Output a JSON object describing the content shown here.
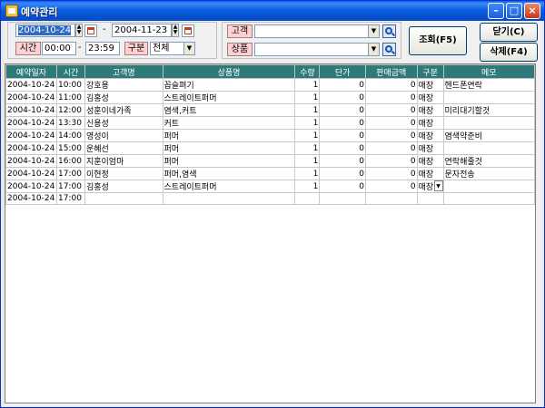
{
  "window": {
    "title": "예약관리"
  },
  "filters": {
    "date_from": "2004-10-24",
    "date_to": "2004-11-23",
    "date_dash": "-",
    "time_label": "시간",
    "time_from": "00:00",
    "time_dash": "-",
    "time_to": "23:59",
    "type_label": "구분",
    "type_value": "전체",
    "customer_label": "고객",
    "customer_value": "",
    "product_label": "상품",
    "product_value": ""
  },
  "buttons": {
    "search": "조회(F5)",
    "close": "닫기(C)",
    "delete": "삭제(F4)"
  },
  "table": {
    "columns": [
      "예약일자",
      "시간",
      "고객명",
      "상품명",
      "수량",
      "단가",
      "판매금액",
      "구분",
      "메모"
    ],
    "rows": [
      [
        "2004-10-24",
        "10:00",
        "강호용",
        "꼽슬펴기",
        "1",
        "0",
        "0",
        "매장",
        "헨드폰연락"
      ],
      [
        "2004-10-24",
        "11:00",
        "김홍성",
        "스트레이트퍼머",
        "1",
        "0",
        "0",
        "매장",
        ""
      ],
      [
        "2004-10-24",
        "12:00",
        "성훈이네가족",
        "염색,커트",
        "1",
        "0",
        "0",
        "매장",
        "미리대기할것"
      ],
      [
        "2004-10-24",
        "13:30",
        "신용성",
        "커트",
        "1",
        "0",
        "0",
        "매장",
        ""
      ],
      [
        "2004-10-24",
        "14:00",
        "영성이",
        "퍼머",
        "1",
        "0",
        "0",
        "매장",
        "염색약준비"
      ],
      [
        "2004-10-24",
        "15:00",
        "운혜선",
        "퍼머",
        "1",
        "0",
        "0",
        "매장",
        ""
      ],
      [
        "2004-10-24",
        "16:00",
        "지훈이엄마",
        "퍼머",
        "1",
        "0",
        "0",
        "매장",
        "연락해줄것"
      ],
      [
        "2004-10-24",
        "17:00",
        "이현정",
        "퍼머,염색",
        "1",
        "0",
        "0",
        "매장",
        "문자전송"
      ],
      [
        "2004-10-24",
        "17:00",
        "김홍성",
        "스트레이트퍼머",
        "1",
        "0",
        "0",
        "매장",
        ""
      ],
      [
        "2004-10-24",
        "17:00",
        "",
        "",
        "",
        "",
        "",
        "",
        ""
      ]
    ]
  }
}
